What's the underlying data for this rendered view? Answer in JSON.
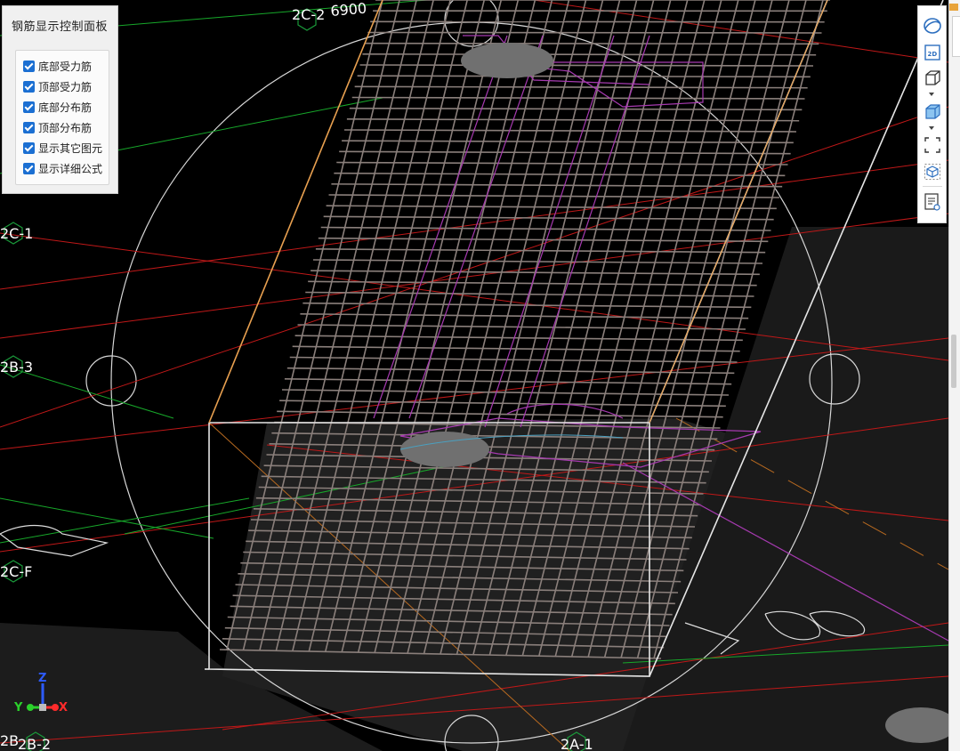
{
  "panel": {
    "title": "钢筋显示控制面板",
    "options": [
      {
        "label": "底部受力筋",
        "checked": true
      },
      {
        "label": "顶部受力筋",
        "checked": true
      },
      {
        "label": "底部分布筋",
        "checked": true
      },
      {
        "label": "顶部分布筋",
        "checked": true
      },
      {
        "label": "显示其它图元",
        "checked": true
      },
      {
        "label": "显示详细公式",
        "checked": true
      }
    ]
  },
  "axes": {
    "top_label": "2C-2",
    "top_dimension": "6900",
    "left_1": "2C-1",
    "left_2": "2B-3",
    "left_3": "2C-F",
    "bottom_left_1": "2B",
    "bottom_left_2": "2B-2",
    "bottom_mid": "2A-1"
  },
  "gizmo": {
    "x": "X",
    "y": "Y",
    "z": "Z"
  },
  "toolbar": {
    "icons": [
      "orbit-icon",
      "2d-view-icon",
      "3d-box-icon",
      "solid-box-icon",
      "fit-frame-icon",
      "iso-view-icon",
      "formula-view-icon"
    ],
    "view_2d_label": "2D"
  },
  "colors": {
    "panel_bg": "#f0f0f0",
    "checkbox": "#1b6fd2",
    "grid_rebar": "#8a7f7b",
    "red_line": "#c01818",
    "green_line": "#17a82a",
    "magenta_line": "#a63ab0",
    "orange_edge": "#e0a060"
  }
}
